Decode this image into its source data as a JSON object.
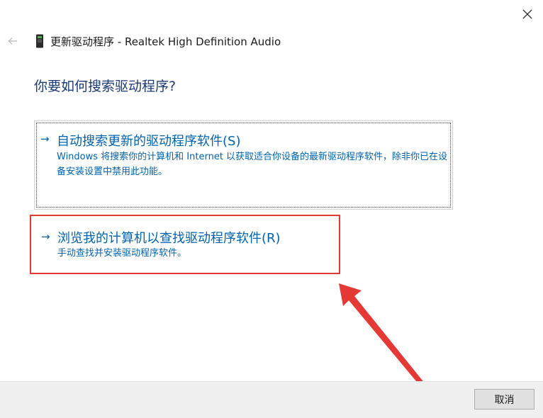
{
  "window": {
    "title": "更新驱动程序 - Realtek High Definition Audio"
  },
  "icons": {
    "close": "close-icon",
    "back": "back-arrow-icon",
    "device": "device-icon",
    "option_arrow": "arrow-right-icon"
  },
  "heading": "你要如何搜索驱动程序?",
  "options": [
    {
      "arrow": "→",
      "title": "自动搜索更新的驱动程序软件(S)",
      "desc": "Windows 将搜索你的计算机和 Internet 以获取适合你设备的最新驱动程序软件，除非你已在设备安装设置中禁用此功能。"
    },
    {
      "arrow": "→",
      "title": "浏览我的计算机以查找驱动程序软件(R)",
      "desc": "手动查找并安装驱动程序软件。"
    }
  ],
  "footer": {
    "cancel_label": "取消"
  },
  "colors": {
    "link_blue": "#0063b1",
    "heading_blue": "#1c3a78",
    "highlight_red": "#e53935",
    "footer_bg": "#f0f0f0"
  }
}
